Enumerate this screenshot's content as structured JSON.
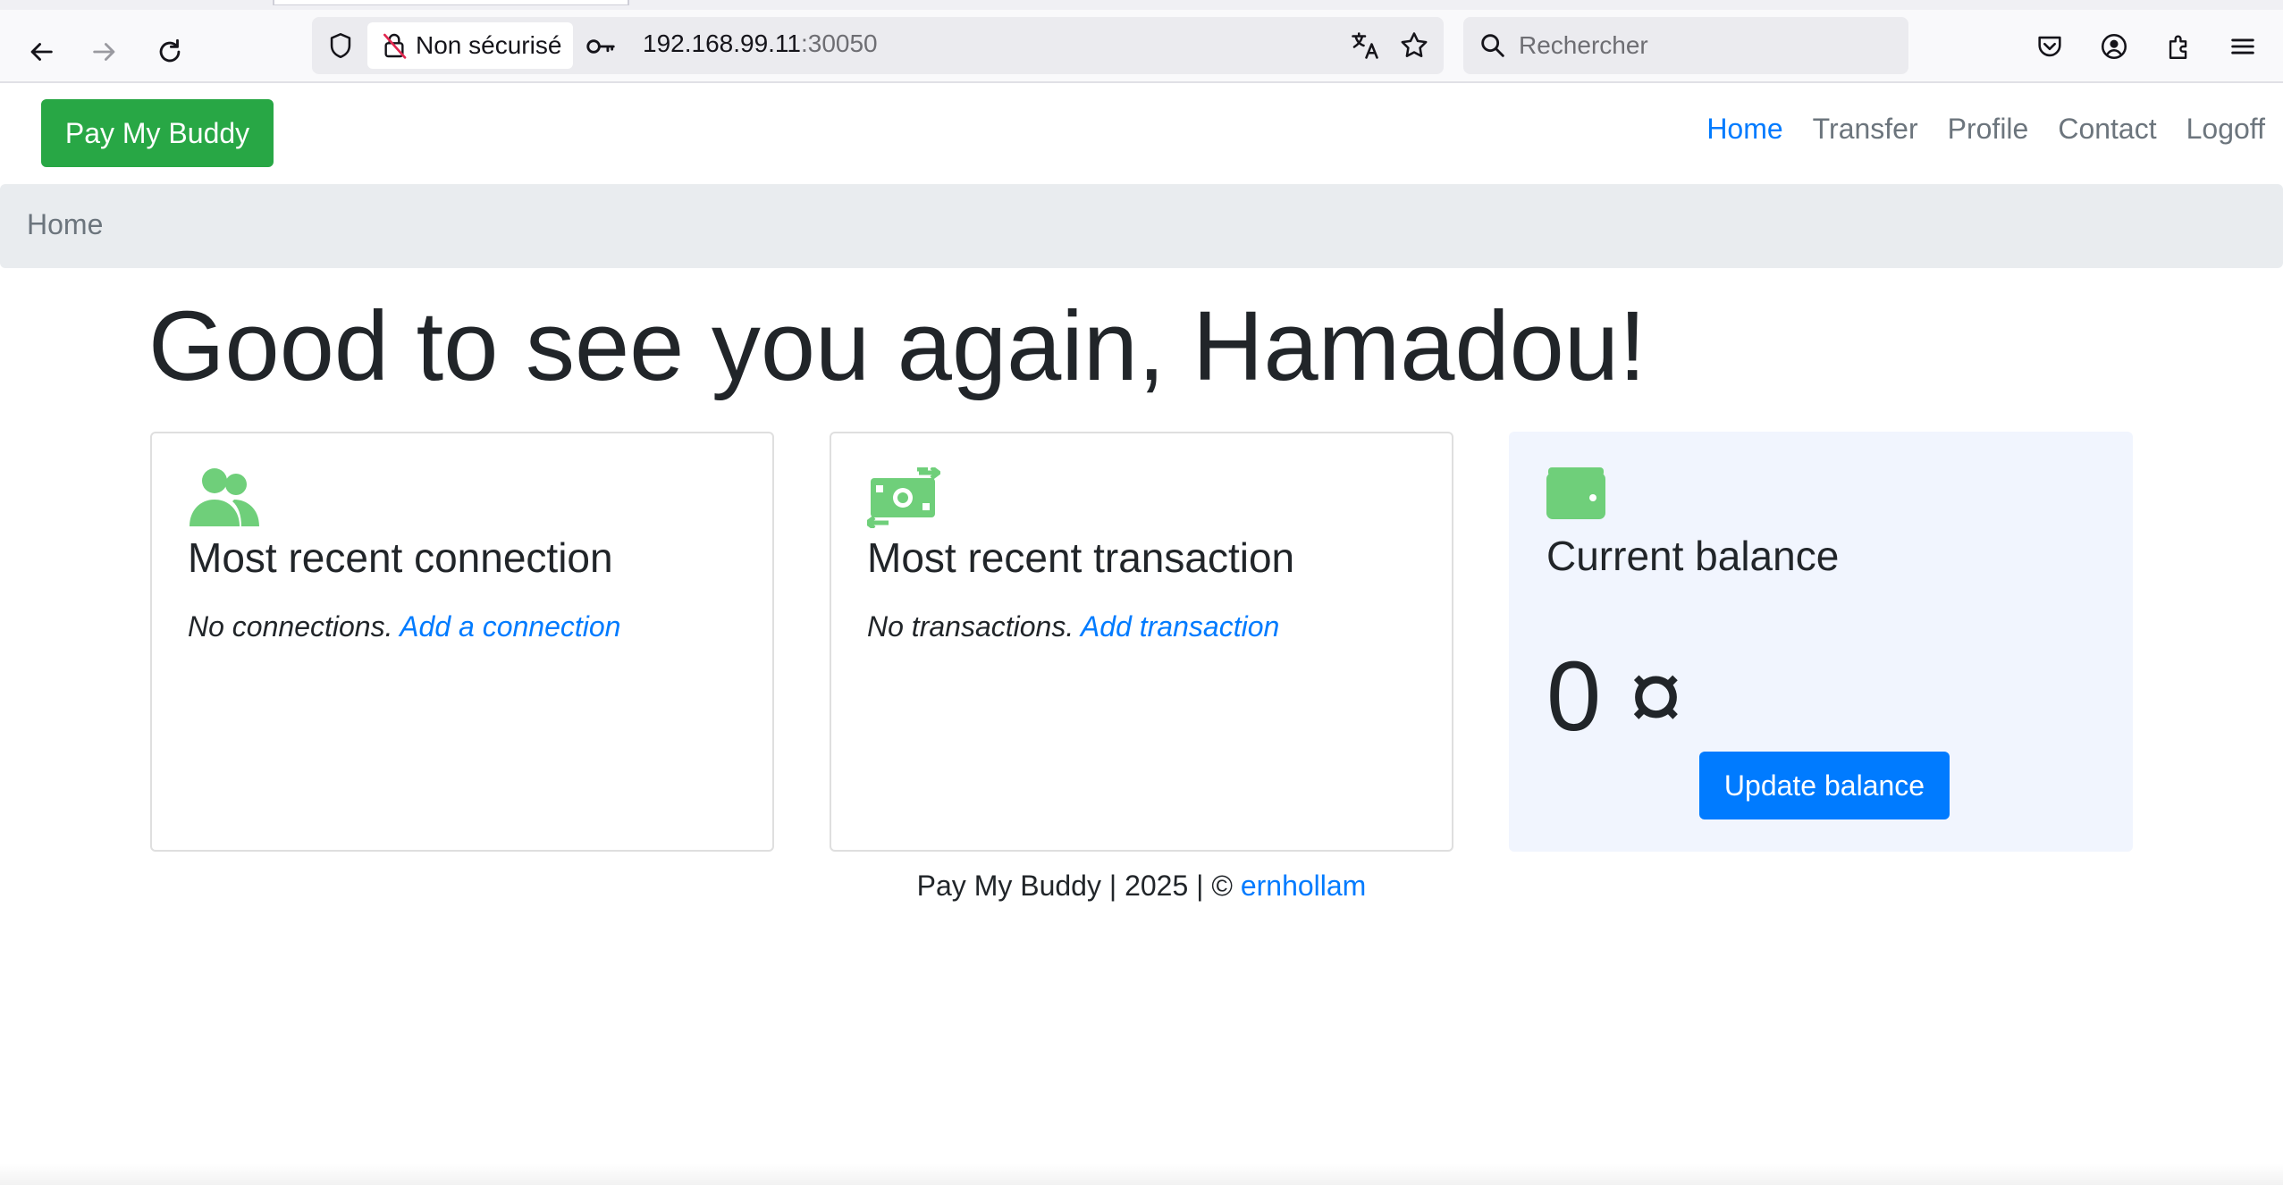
{
  "browser": {
    "security_label": "Non sécurisé",
    "url_host": "192.168.99.11",
    "url_port": ":30050",
    "search_placeholder": "Rechercher"
  },
  "navbar": {
    "brand": "Pay My Buddy",
    "links": [
      "Home",
      "Transfer",
      "Profile",
      "Contact",
      "Logoff"
    ],
    "active_link": "Home"
  },
  "breadcrumb": {
    "current": "Home"
  },
  "main": {
    "greeting": "Good to see you again, Hamadou!",
    "connection_card": {
      "title": "Most recent connection",
      "empty_text": "No connections.",
      "link": "Add a connection",
      "icon": "users-icon"
    },
    "transaction_card": {
      "title": "Most recent transaction",
      "empty_text": "No transactions.",
      "link": "Add transaction",
      "icon": "money-transfer-icon"
    },
    "balance_card": {
      "title": "Current balance",
      "amount": "0 ¤",
      "button": "Update balance",
      "icon": "wallet-icon"
    }
  },
  "footer": {
    "text": "Pay My Buddy | 2025 | © ",
    "author_link": "ernhollam"
  },
  "colors": {
    "brand_green": "#28a745",
    "icon_green": "#6fcf7a",
    "link_blue": "#007bff",
    "breadcrumb_bg": "#e9ecef",
    "balance_card_bg": "#f1f5fe"
  }
}
